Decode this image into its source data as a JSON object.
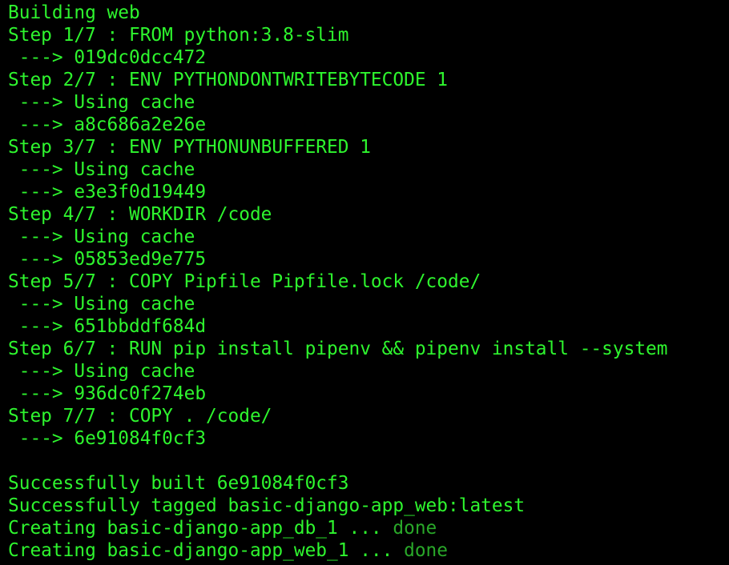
{
  "colors": {
    "background": "#000000",
    "text": "#2ef52e",
    "done": "#29a829"
  },
  "lines": [
    {
      "text": "Building web"
    },
    {
      "text": "Step 1/7 : FROM python:3.8-slim"
    },
    {
      "text": " ---> 019dc0dcc472"
    },
    {
      "text": "Step 2/7 : ENV PYTHONDONTWRITEBYTECODE 1"
    },
    {
      "text": " ---> Using cache"
    },
    {
      "text": " ---> a8c686a2e26e"
    },
    {
      "text": "Step 3/7 : ENV PYTHONUNBUFFERED 1"
    },
    {
      "text": " ---> Using cache"
    },
    {
      "text": " ---> e3e3f0d19449"
    },
    {
      "text": "Step 4/7 : WORKDIR /code"
    },
    {
      "text": " ---> Using cache"
    },
    {
      "text": " ---> 05853ed9e775"
    },
    {
      "text": "Step 5/7 : COPY Pipfile Pipfile.lock /code/"
    },
    {
      "text": " ---> Using cache"
    },
    {
      "text": " ---> 651bbddf684d"
    },
    {
      "text": "Step 6/7 : RUN pip install pipenv && pipenv install --system"
    },
    {
      "text": " ---> Using cache"
    },
    {
      "text": " ---> 936dc0f274eb"
    },
    {
      "text": "Step 7/7 : COPY . /code/"
    },
    {
      "text": " ---> 6e91084f0cf3"
    },
    {
      "text": ""
    },
    {
      "text": "Successfully built 6e91084f0cf3"
    },
    {
      "text": "Successfully tagged basic-django-app_web:latest"
    },
    {
      "text": "Creating basic-django-app_db_1 ... ",
      "status": "done"
    },
    {
      "text": "Creating basic-django-app_web_1 ... ",
      "status": "done"
    }
  ]
}
